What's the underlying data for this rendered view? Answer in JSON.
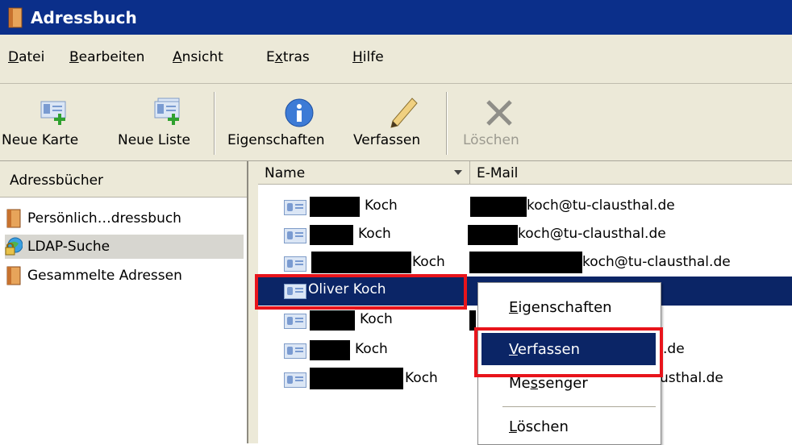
{
  "window": {
    "title": "Adressbuch"
  },
  "menu": [
    "Datei",
    "Bearbeiten",
    "Ansicht",
    "Extras",
    "Hilfe"
  ],
  "toolbar": {
    "new_card": "Neue Karte",
    "new_list": "Neue Liste",
    "properties": "Eigenschaften",
    "compose": "Verfassen",
    "delete": "Löschen"
  },
  "sidebar": {
    "header": "Adressbücher",
    "items": [
      {
        "label": "Persönlich…dressbuch",
        "icon": "address-book-icon"
      },
      {
        "label": "LDAP-Suche",
        "icon": "ldap-globe-icon",
        "selected": true
      },
      {
        "label": "Gesammelte Adressen",
        "icon": "address-book-icon"
      }
    ]
  },
  "columns": {
    "name": "Name",
    "email": "E-Mail"
  },
  "rows": [
    {
      "name": "Koch",
      "email": "koch@tu-clausthal.de"
    },
    {
      "name": "Koch",
      "email": "koch@tu-clausthal.de"
    },
    {
      "name": "Koch",
      "email": "koch@tu-clausthal.de"
    },
    {
      "name": "Oliver Koch",
      "email": "",
      "selected": true
    },
    {
      "name": "Koch",
      "email": ""
    },
    {
      "name": "Koch",
      "email": ".de"
    },
    {
      "name": "Koch",
      "email": "usthal.de"
    }
  ],
  "context_menu": {
    "items": [
      "Eigenschaften",
      "Verfassen",
      "Messenger",
      "Löschen"
    ],
    "highlighted": "Verfassen"
  },
  "colors": {
    "title_bar": "#0b2f8a",
    "selection": "#0b2566",
    "highlight_box": "#e8141b"
  }
}
